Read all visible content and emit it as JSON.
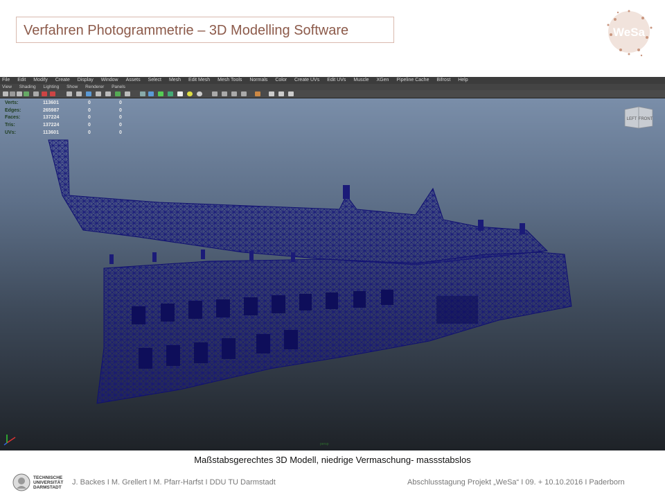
{
  "slide": {
    "title": "Verfahren Photogrammetrie – 3D Modelling Software",
    "caption": "Maßstabsgerechtes 3D Modell, niedrige Vermaschung- massstabslos",
    "footer_left": "J. Backes I M. Grellert I M. Pfarr-Harfst I DDU TU Darmstadt",
    "footer_right": "Abschlusstagung Projekt „WeSa“ I 09. + 10.10.2016 I Paderborn",
    "logo_text": "WeSa",
    "tu_logo_lines": [
      "TECHNISCHE",
      "UNIVERSITÄT",
      "DARMSTADT"
    ]
  },
  "maya": {
    "menu": [
      "File",
      "Edit",
      "Modify",
      "Create",
      "Display",
      "Window",
      "Assets",
      "Select",
      "Mesh",
      "Edit Mesh",
      "Mesh Tools",
      "Normals",
      "Color",
      "Create UVs",
      "Edit UVs",
      "Muscle",
      "XGen",
      "Pipeline Cache",
      "Bifrost",
      "Help"
    ],
    "panel_menu": [
      "View",
      "Shading",
      "Lighting",
      "Show",
      "Renderer",
      "Panels"
    ],
    "hud": [
      {
        "label": "Verts:",
        "v1": "113601",
        "v2": "0",
        "v3": "0"
      },
      {
        "label": "Edges:",
        "v1": "265987",
        "v2": "0",
        "v3": "0"
      },
      {
        "label": "Faces:",
        "v1": "137224",
        "v2": "0",
        "v3": "0"
      },
      {
        "label": "Tris:",
        "v1": "137224",
        "v2": "0",
        "v3": "0"
      },
      {
        "label": "UVs:",
        "v1": "113601",
        "v2": "0",
        "v3": "0"
      }
    ],
    "viewcube": {
      "left": "LEFT",
      "front": "FRONT"
    },
    "camera_label": "persp",
    "colors": {
      "mesh": "#1a1a7a",
      "viewport_top": "#7a8ea9",
      "viewport_bottom": "#1e2227"
    }
  }
}
